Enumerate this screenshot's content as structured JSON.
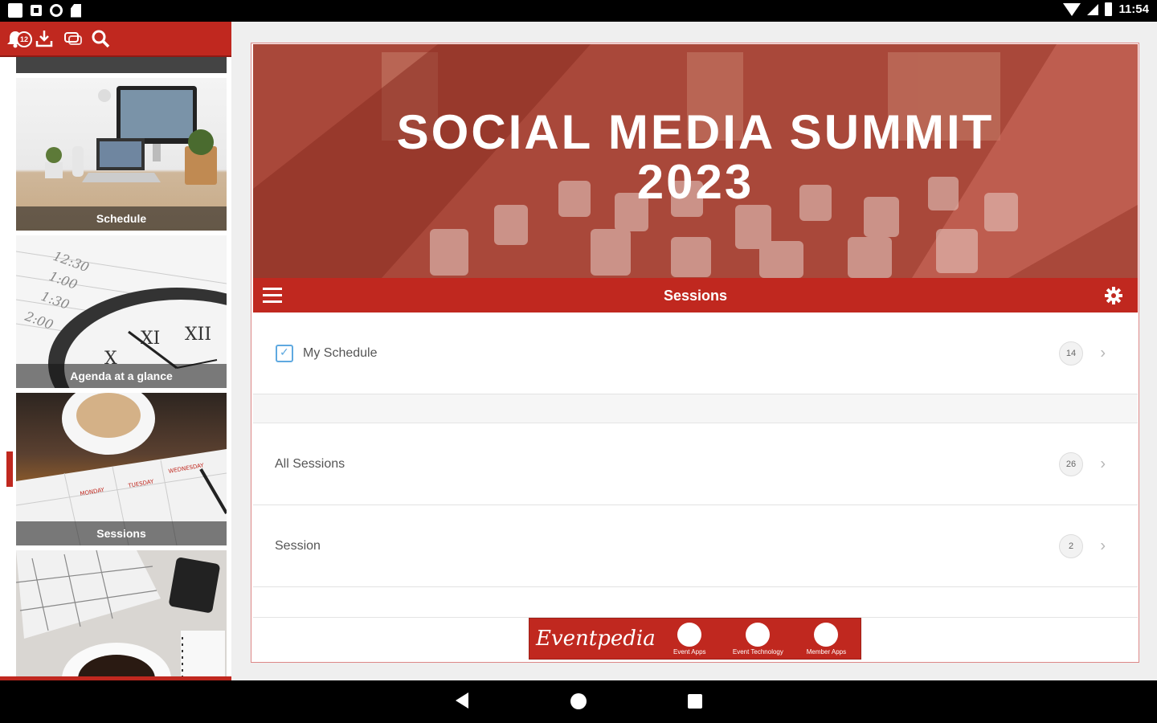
{
  "status_bar": {
    "time": "11:54"
  },
  "toolbar": {
    "notification_count": "12"
  },
  "tiles": [
    {
      "label": "Schedule"
    },
    {
      "label": "Agenda at a glance"
    },
    {
      "label": "Sessions"
    },
    {
      "label": ""
    }
  ],
  "banner": {
    "title_line1": "SOCIAL MEDIA SUMMIT",
    "title_line2": "2023"
  },
  "section": {
    "title": "Sessions"
  },
  "list": [
    {
      "label": "My Schedule",
      "count": "14"
    },
    {
      "label": "All Sessions",
      "count": "26"
    },
    {
      "label": "Session",
      "count": "2"
    }
  ],
  "ad": {
    "brand": "Eventpedia",
    "items": [
      "Event Apps",
      "Event Technology",
      "Member Apps"
    ]
  },
  "colors": {
    "brand_red": "#c0281f",
    "accent_blue": "#5fa9e0"
  }
}
